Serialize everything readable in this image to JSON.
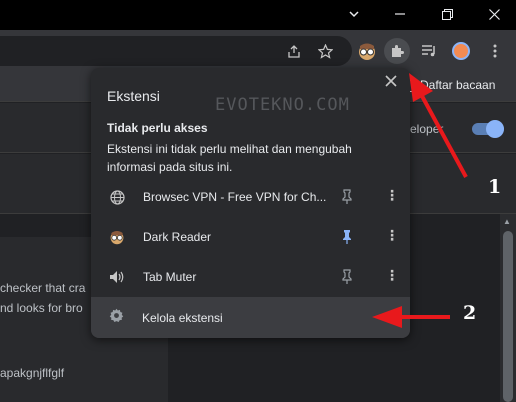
{
  "window": {
    "controls": [
      "chevron-down-icon",
      "minimize-icon",
      "restore-icon",
      "close-icon"
    ]
  },
  "toolbar": {
    "icons": [
      "share-icon",
      "star-icon",
      "dark-reader-icon",
      "puzzle-icon",
      "reading-list-icon",
      "profile-avatar",
      "more-icon"
    ]
  },
  "bookmarks": {
    "reading_list_label": "Daftar bacaan"
  },
  "page": {
    "developer_label": "veloper",
    "line1": "checker that cra",
    "line2": "nd looks for bro",
    "line3": "apakgnjflfglf"
  },
  "popup": {
    "title": "Ekstensi",
    "watermark": "EVOTEKNO.COM",
    "section_title": "Tidak perlu akses",
    "section_desc": "Ekstensi ini tidak perlu melihat dan mengubah informasi pada situs ini.",
    "extensions": [
      {
        "name": "Browsec VPN - Free VPN for Ch...",
        "icon": "globe-icon",
        "pinned": false
      },
      {
        "name": "Dark Reader",
        "icon": "dark-reader-icon",
        "pinned": true
      },
      {
        "name": "Tab Muter",
        "icon": "speaker-icon",
        "pinned": false
      }
    ],
    "manage_label": "Kelola ekstensi"
  },
  "annotations": {
    "label1": "1",
    "label2": "2",
    "arrow_color": "#e8191c"
  },
  "colors": {
    "accent": "#8ab4f8",
    "popup_bg": "#292a2d",
    "toolbar_bg": "#35363a"
  }
}
